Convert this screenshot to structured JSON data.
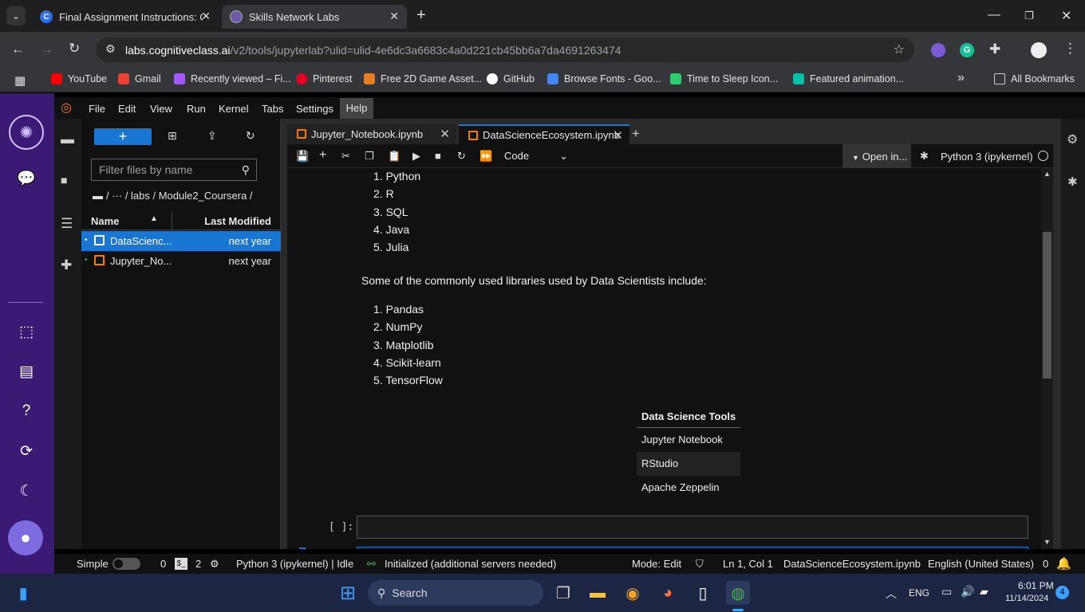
{
  "browser": {
    "tabs": [
      {
        "title": "Final Assignment Instructions: C",
        "favicon_color": "#2c6fe6",
        "active": false
      },
      {
        "title": "Skills Network Labs",
        "favicon_color": "#6b5aa8",
        "active": true
      }
    ],
    "new_tab": "+",
    "url_host": "labs.cognitiveclass.ai",
    "url_path": "/v2/tools/jupyterlab?ulid=ulid-4e6dc3a6683c4a0d221cb45bb6a7da4691263474",
    "bookmarks": [
      {
        "label": "YouTube",
        "color": "#ff0000"
      },
      {
        "label": "Gmail",
        "color": "#ea4335"
      },
      {
        "label": "Recently viewed – Fi...",
        "color": "#a259ff"
      },
      {
        "label": "Pinterest",
        "color": "#e60023"
      },
      {
        "label": "Free 2D Game Asset...",
        "color": "#e67e22"
      },
      {
        "label": "GitHub",
        "color": "#ffffff"
      },
      {
        "label": "Browse Fonts - Goo...",
        "color": "#4285f4"
      },
      {
        "label": "Time to Sleep Icon...",
        "color": "#2ecc71"
      },
      {
        "label": "Featured animation...",
        "color": "#00c2a8"
      }
    ],
    "more_bookmarks": "»",
    "all_bookmarks": "All Bookmarks"
  },
  "menu": [
    "File",
    "Edit",
    "View",
    "Run",
    "Kernel",
    "Tabs",
    "Settings",
    "Help"
  ],
  "filebrowser": {
    "new_label": "+",
    "filter_placeholder": "Filter files by name",
    "breadcrumb": "/  ···  / labs / Module2_Coursera /",
    "col_name": "Name",
    "col_modified": "Last Modified",
    "files": [
      {
        "name": "DataScienc...",
        "modified": "next year",
        "selected": true
      },
      {
        "name": "Jupyter_No...",
        "modified": "next year",
        "selected": false
      }
    ]
  },
  "doctabs": [
    {
      "title": "Jupyter_Notebook.ipynb",
      "active": false
    },
    {
      "title": "DataScienceEcosystem.ipynb",
      "active": true
    }
  ],
  "nbtoolbar": {
    "cell_type": "Code",
    "open_in": "Open in...",
    "kernel": "Python 3 (ipykernel)"
  },
  "notebook": {
    "languages": [
      "1. Python",
      "2. R",
      "3. SQL",
      "4. Java",
      "5. Julia"
    ],
    "libraries_intro": "Some of the commonly used libraries used by Data Scientists include:",
    "libraries": [
      "1. Pandas",
      "2. NumPy",
      "3. Matplotlib",
      "4. Scikit-learn",
      "5. TensorFlow"
    ],
    "table_header": "Data Science Tools",
    "tools": [
      "Jupyter Notebook",
      "RStudio",
      "Apache Zeppelin"
    ],
    "prompt": "[ ]:"
  },
  "status": {
    "mode": "Simple",
    "terminals": "0",
    "kernels": "2",
    "kernel_status": "Python 3 (ipykernel) | Idle",
    "lsp": "Initialized (additional servers needed)",
    "edit_mode": "Mode: Edit",
    "position": "Ln 1, Col 1",
    "filename": "DataScienceEcosystem.ipynb",
    "language": "English (United States)",
    "notifications": "0"
  },
  "taskbar": {
    "search": "Search",
    "lang": "ENG",
    "time": "6:01 PM",
    "date": "11/14/2024",
    "badge": "4"
  }
}
